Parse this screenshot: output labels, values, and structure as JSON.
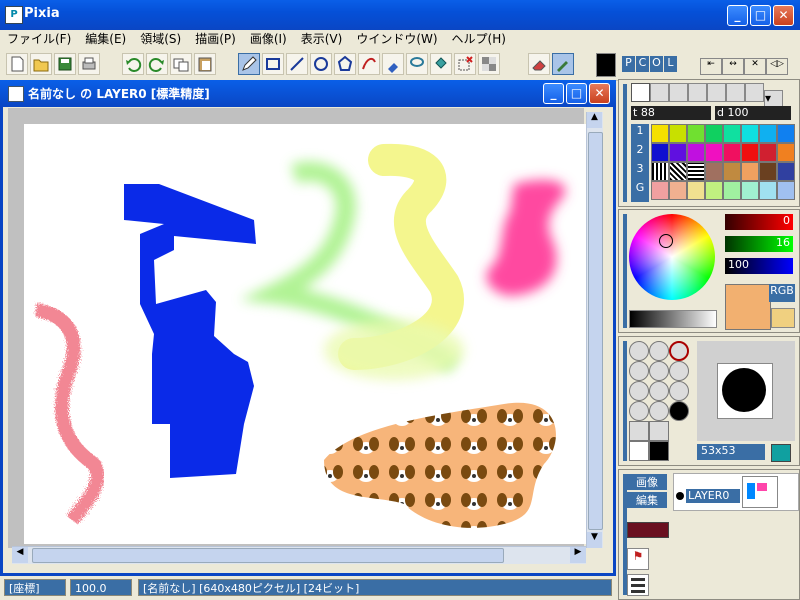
{
  "app": {
    "title": "Pixia",
    "icon_text": "P"
  },
  "window_controls": {
    "minimize": "_",
    "maximize": "□",
    "close": "✕"
  },
  "menu": [
    "ファイル(F)",
    "編集(E)",
    "領域(S)",
    "描画(P)",
    "画像(I)",
    "表示(V)",
    "ウインドウ(W)",
    "ヘルプ(H)"
  ],
  "panel_tabs": [
    "P",
    "C",
    "O",
    "L"
  ],
  "doc": {
    "title": "名前なし の LAYER0 [標準精度]",
    "status_coord_label": "[座標]",
    "status_zoom": "100.0",
    "status_info": "[名前なし] [640x480ピクセル] [24ビット]"
  },
  "pen": {
    "t_label": "t",
    "t_value": "88",
    "d_label": "d",
    "d_value": "100"
  },
  "palette_rows": [
    "1",
    "2",
    "3",
    "G"
  ],
  "color": {
    "r_value": "0",
    "g_value": "16",
    "b_value": "100",
    "mode": "RGB"
  },
  "brush_size": "53x53",
  "layer": {
    "image_btn": "画像",
    "edit_btn": "編集",
    "layer_name": "LAYER0"
  },
  "colors": {
    "accent": "#0a46c4",
    "foreground": "#000000"
  }
}
